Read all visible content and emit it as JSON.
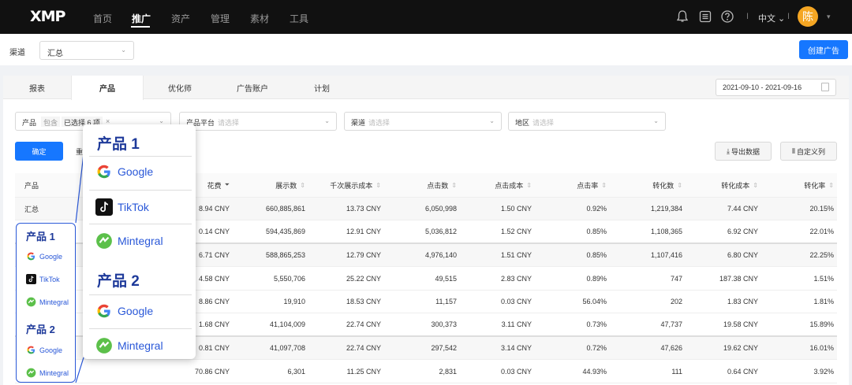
{
  "nav": {
    "logo": "XMP",
    "items": [
      "首页",
      "推广",
      "资产",
      "管理",
      "素材",
      "工具"
    ],
    "active": "推广",
    "sep": "I",
    "lang": "中文 ⌄",
    "avatar": "陈",
    "caret": "▾",
    "icons": [
      "bell-icon",
      "list-icon",
      "help-icon"
    ]
  },
  "channel": {
    "label": "渠道",
    "value": "汇总",
    "chevron": "⌄"
  },
  "create_button": "创建广告",
  "tabs": [
    "报表",
    "产品",
    "优化师",
    "广告账户",
    "计划"
  ],
  "active_tab": "产品",
  "date_range": "2021-09-10 - 2021-09-16",
  "filters": {
    "product": {
      "label": "产品",
      "mode": "包含",
      "selected": "已选择 6 项",
      "close": "×",
      "chevron": "⌄"
    },
    "platform": {
      "label": "产品平台",
      "placeholder": "请选择"
    },
    "channel": {
      "label": "渠道",
      "placeholder": "请选择"
    },
    "region": {
      "label": "地区",
      "placeholder": "请选择"
    }
  },
  "buttons": {
    "ok": "确定",
    "reset": "重",
    "export": "导出数据",
    "custom_cols": "自定义列"
  },
  "table": {
    "headers": [
      "产品",
      "花费",
      "展示数",
      "千次展示成本",
      "点击数",
      "点击成本",
      "点击率",
      "转化数",
      "转化成本",
      "转化率"
    ],
    "sort_icon": "⇕",
    "sort_active": "⏷",
    "rows": [
      [
        "汇总",
        "8.94 CNY",
        "660,885,861",
        "13.73 CNY",
        "6,050,998",
        "1.50 CNY",
        "0.92%",
        "1,219,384",
        "7.44 CNY",
        "20.15%"
      ],
      [
        "",
        "0.14 CNY",
        "594,435,869",
        "12.91 CNY",
        "5,036,812",
        "1.52 CNY",
        "0.85%",
        "1,108,365",
        "6.92 CNY",
        "22.01%"
      ],
      [
        "",
        "6.71 CNY",
        "588,865,253",
        "12.79 CNY",
        "4,976,140",
        "1.51 CNY",
        "0.85%",
        "1,107,416",
        "6.80 CNY",
        "22.25%"
      ],
      [
        "",
        "4.58 CNY",
        "5,550,706",
        "25.22 CNY",
        "49,515",
        "2.83 CNY",
        "0.89%",
        "747",
        "187.38 CNY",
        "1.51%"
      ],
      [
        "",
        "8.86 CNY",
        "19,910",
        "18.53 CNY",
        "11,157",
        "0.03 CNY",
        "56.04%",
        "202",
        "1.83 CNY",
        "1.81%"
      ],
      [
        "",
        "1.68 CNY",
        "41,104,009",
        "22.74 CNY",
        "300,373",
        "3.11 CNY",
        "0.73%",
        "47,737",
        "19.58 CNY",
        "15.89%"
      ],
      [
        "",
        "0.81 CNY",
        "41,097,708",
        "22.74 CNY",
        "297,542",
        "3.14 CNY",
        "0.72%",
        "47,626",
        "19.62 CNY",
        "16.01%"
      ],
      [
        "",
        "70.86 CNY",
        "6,301",
        "11.25 CNY",
        "2,831",
        "0.03 CNY",
        "44.93%",
        "111",
        "0.64 CNY",
        "3.92%"
      ]
    ]
  },
  "left_column": {
    "group1": "产品 1",
    "google1": "Google",
    "tiktok": "TikTok",
    "mintegral1": "Mintegral",
    "group2": "产品 2",
    "google2": "Google",
    "mintegral2": "Mintegral"
  },
  "popover": {
    "group1": "产品 1",
    "google1": "Google",
    "tiktok": "TikTok",
    "mintegral1": "Mintegral",
    "group2": "产品 2",
    "google2": "Google",
    "mintegral2": "Mintegral"
  },
  "colors": {
    "primary": "#1677ff",
    "nav_bg": "#111111",
    "highlight_blue": "#2a58d8",
    "avatar": "#f5a623"
  }
}
